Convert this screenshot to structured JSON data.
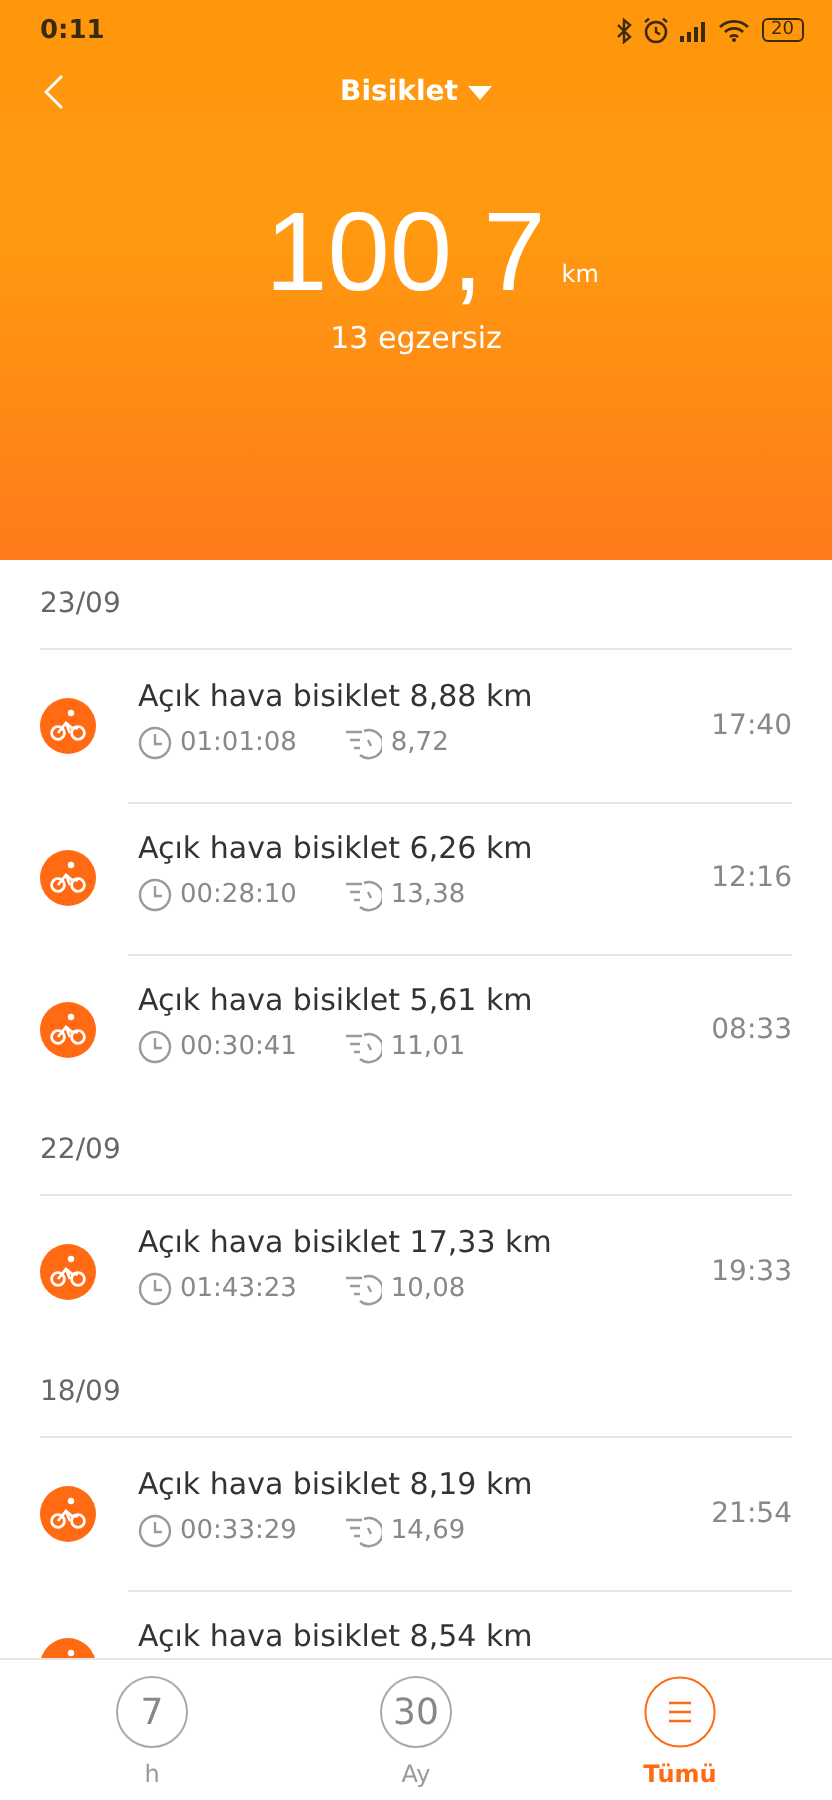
{
  "status_bar": {
    "time": "0:11",
    "battery": "20"
  },
  "header": {
    "title": "Bisiklet",
    "total": "100,7",
    "unit": "km",
    "count": "13 egzersiz"
  },
  "groups": [
    {
      "date": "23/09",
      "workouts": [
        {
          "title": "Açık hava bisiklet 8,88 km",
          "duration": "01:01:08",
          "pace": "8,72",
          "time": "17:40"
        },
        {
          "title": "Açık hava bisiklet 6,26 km",
          "duration": "00:28:10",
          "pace": "13,38",
          "time": "12:16"
        },
        {
          "title": "Açık hava bisiklet 5,61 km",
          "duration": "00:30:41",
          "pace": "11,01",
          "time": "08:33"
        }
      ]
    },
    {
      "date": "22/09",
      "workouts": [
        {
          "title": "Açık hava bisiklet 17,33 km",
          "duration": "01:43:23",
          "pace": "10,08",
          "time": "19:33"
        }
      ]
    },
    {
      "date": "18/09",
      "workouts": [
        {
          "title": "Açık hava bisiklet 8,19 km",
          "duration": "00:33:29",
          "pace": "14,69",
          "time": "21:54"
        },
        {
          "title": "Açık hava bisiklet 8,54 km"
        }
      ]
    }
  ],
  "tabs": [
    {
      "kind": "number",
      "value": "7",
      "label": "h",
      "selected": false
    },
    {
      "kind": "number",
      "value": "30",
      "label": "Ay",
      "selected": false
    },
    {
      "kind": "menu",
      "label": "Tümü",
      "selected": true
    }
  ]
}
